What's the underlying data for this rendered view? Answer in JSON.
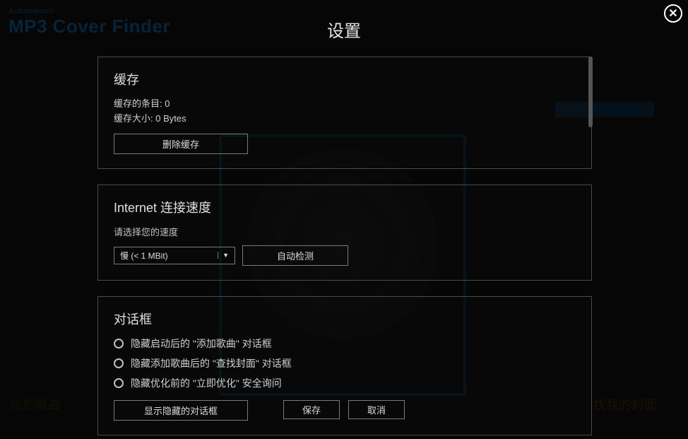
{
  "app": {
    "brand": "Ashampoo®",
    "name": "MP3 Cover Finder"
  },
  "modal": {
    "title": "设置",
    "footer": {
      "save": "保存",
      "cancel": "取消"
    }
  },
  "cache": {
    "title": "缓存",
    "entries_label": "缓存的条目:",
    "entries_value": "0",
    "size_label": "缓存大小:",
    "size_value": "0 Bytes",
    "clear_btn": "删除缓存"
  },
  "internet": {
    "title": "Internet 连接速度",
    "prompt": "请选择您的速度",
    "selected": "慢 (< 1 MBit)",
    "detect_btn": "自动检测"
  },
  "dialogs": {
    "title": "对话框",
    "opt1": "隐藏启动后的 \"添加歌曲\" 对话框",
    "opt2": "隐藏添加歌曲后的 \"查找封面\" 对话框",
    "opt3": "隐藏优化前的 \"立即优化\" 安全询问",
    "show_btn": "显示隐藏的对话框"
  }
}
